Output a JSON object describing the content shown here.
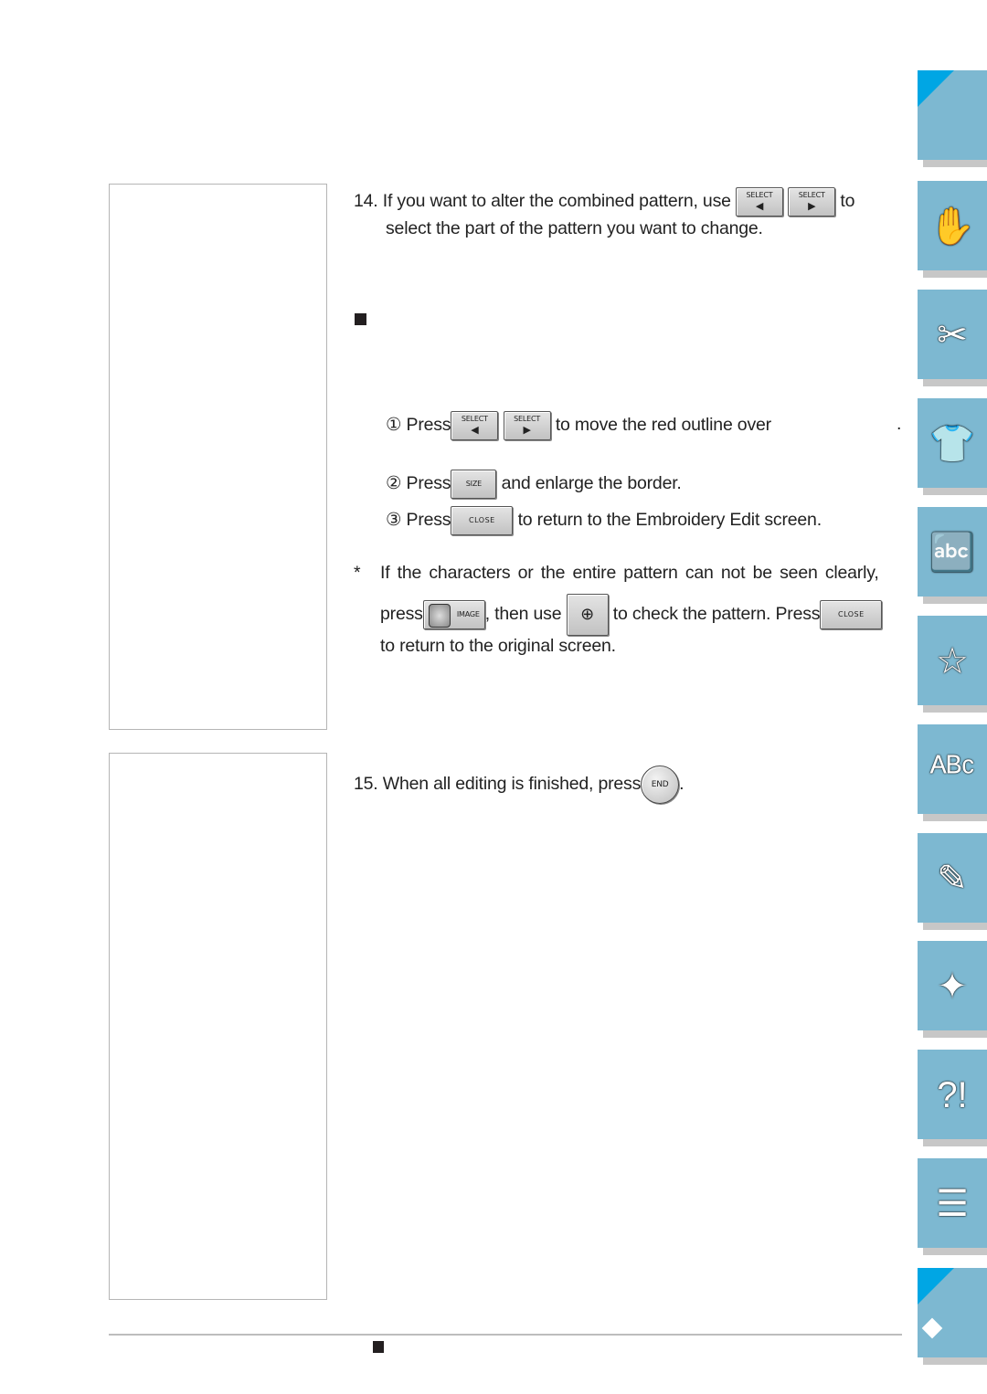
{
  "step14": {
    "number": "14.",
    "text_before": "If you want to alter the combined pattern, use",
    "text_after": "to",
    "line2": "select the part of the pattern you want to change."
  },
  "buttons": {
    "select_label": "SELECT",
    "left_arrow": "◀",
    "right_arrow": "▶",
    "size_label": "SIZE",
    "close_label": "CLOSE",
    "image_label": "IMAGE",
    "zoom_glyph": "⊕",
    "end_label": "END"
  },
  "substeps": [
    {
      "marker": "①",
      "press": "Press",
      "text": "to move the red outline over",
      "trail": "."
    },
    {
      "marker": "②",
      "press": "Press",
      "text": "and enlarge the border."
    },
    {
      "marker": "③",
      "press": "Press",
      "text": "to return to the Embroidery Edit screen."
    }
  ],
  "note": {
    "marker": "*",
    "line1": "If the characters or the entire pattern can not be seen clearly,",
    "line2_a": "press",
    "line2_b": ", then use",
    "line2_c": "to check the pattern. Press",
    "line3": "to return to the original screen."
  },
  "step15": {
    "number": "15.",
    "text": "When all editing is finished, press",
    "trail": "."
  },
  "side_tabs": [
    {
      "name": "contents",
      "icon": "blank-corner-icon",
      "glyph": ""
    },
    {
      "name": "getting-ready",
      "icon": "sewing-machine-hand-icon",
      "glyph": "✋"
    },
    {
      "name": "sewing-basics",
      "icon": "thread-spool-scissors-icon",
      "glyph": "✂"
    },
    {
      "name": "utility-stitches",
      "icon": "shirt-stitch-icon",
      "glyph": "👕"
    },
    {
      "name": "character-decorative",
      "icon": "shirt-abc-icon",
      "glyph": "🔤"
    },
    {
      "name": "embroidery",
      "icon": "embroidery-frame-star-icon",
      "glyph": "☆"
    },
    {
      "name": "embroidery-edit",
      "icon": "shirt-arc-text-icon",
      "glyph": "ᴬᴮᶜ"
    },
    {
      "name": "my-custom-stitch",
      "icon": "shirt-pencil-icon",
      "glyph": "✎"
    },
    {
      "name": "maintenance",
      "icon": "sewing-machine-brush-icon",
      "glyph": "✦"
    },
    {
      "name": "troubleshooting",
      "icon": "sewing-machine-question-icon",
      "glyph": "?!"
    },
    {
      "name": "appendix",
      "icon": "documents-icon",
      "glyph": "☰"
    },
    {
      "name": "index",
      "icon": "diamond-corner-icon",
      "glyph": ""
    }
  ],
  "colors": {
    "tab_bg": "#7db8d1",
    "tab_corner": "#00a6e4",
    "tab_shadow": "#c7c7c7"
  }
}
